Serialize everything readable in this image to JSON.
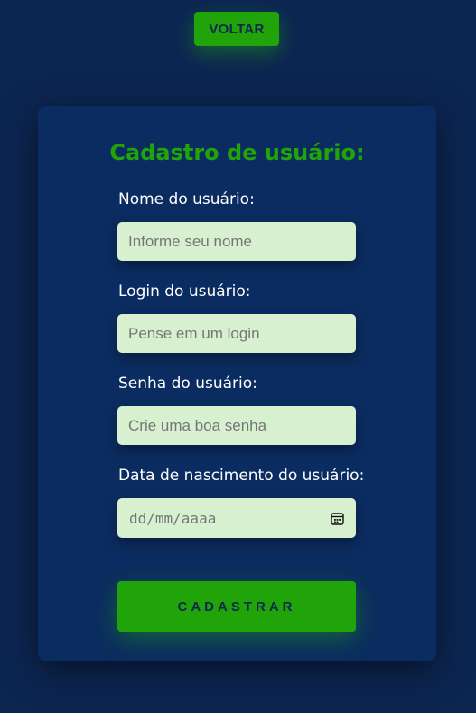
{
  "header": {
    "back_label": "VOLTAR"
  },
  "form": {
    "title": "Cadastro de usuário:",
    "fields": [
      {
        "label": "Nome do usuário:",
        "placeholder": "Informe seu nome"
      },
      {
        "label": "Login do usuário:",
        "placeholder": "Pense em um login"
      },
      {
        "label": "Senha do usuário:",
        "placeholder": "Crie uma boa senha"
      },
      {
        "label": "Data de nascimento do usuário:",
        "placeholder": "dd/mm/aaaa",
        "icon": "calendar-icon"
      }
    ],
    "submit_label": "CADASTRAR"
  },
  "colors": {
    "background": "#0c2652",
    "card": "#0b2c60",
    "accent": "#20a40a",
    "input_bg": "#d7f0d0"
  }
}
